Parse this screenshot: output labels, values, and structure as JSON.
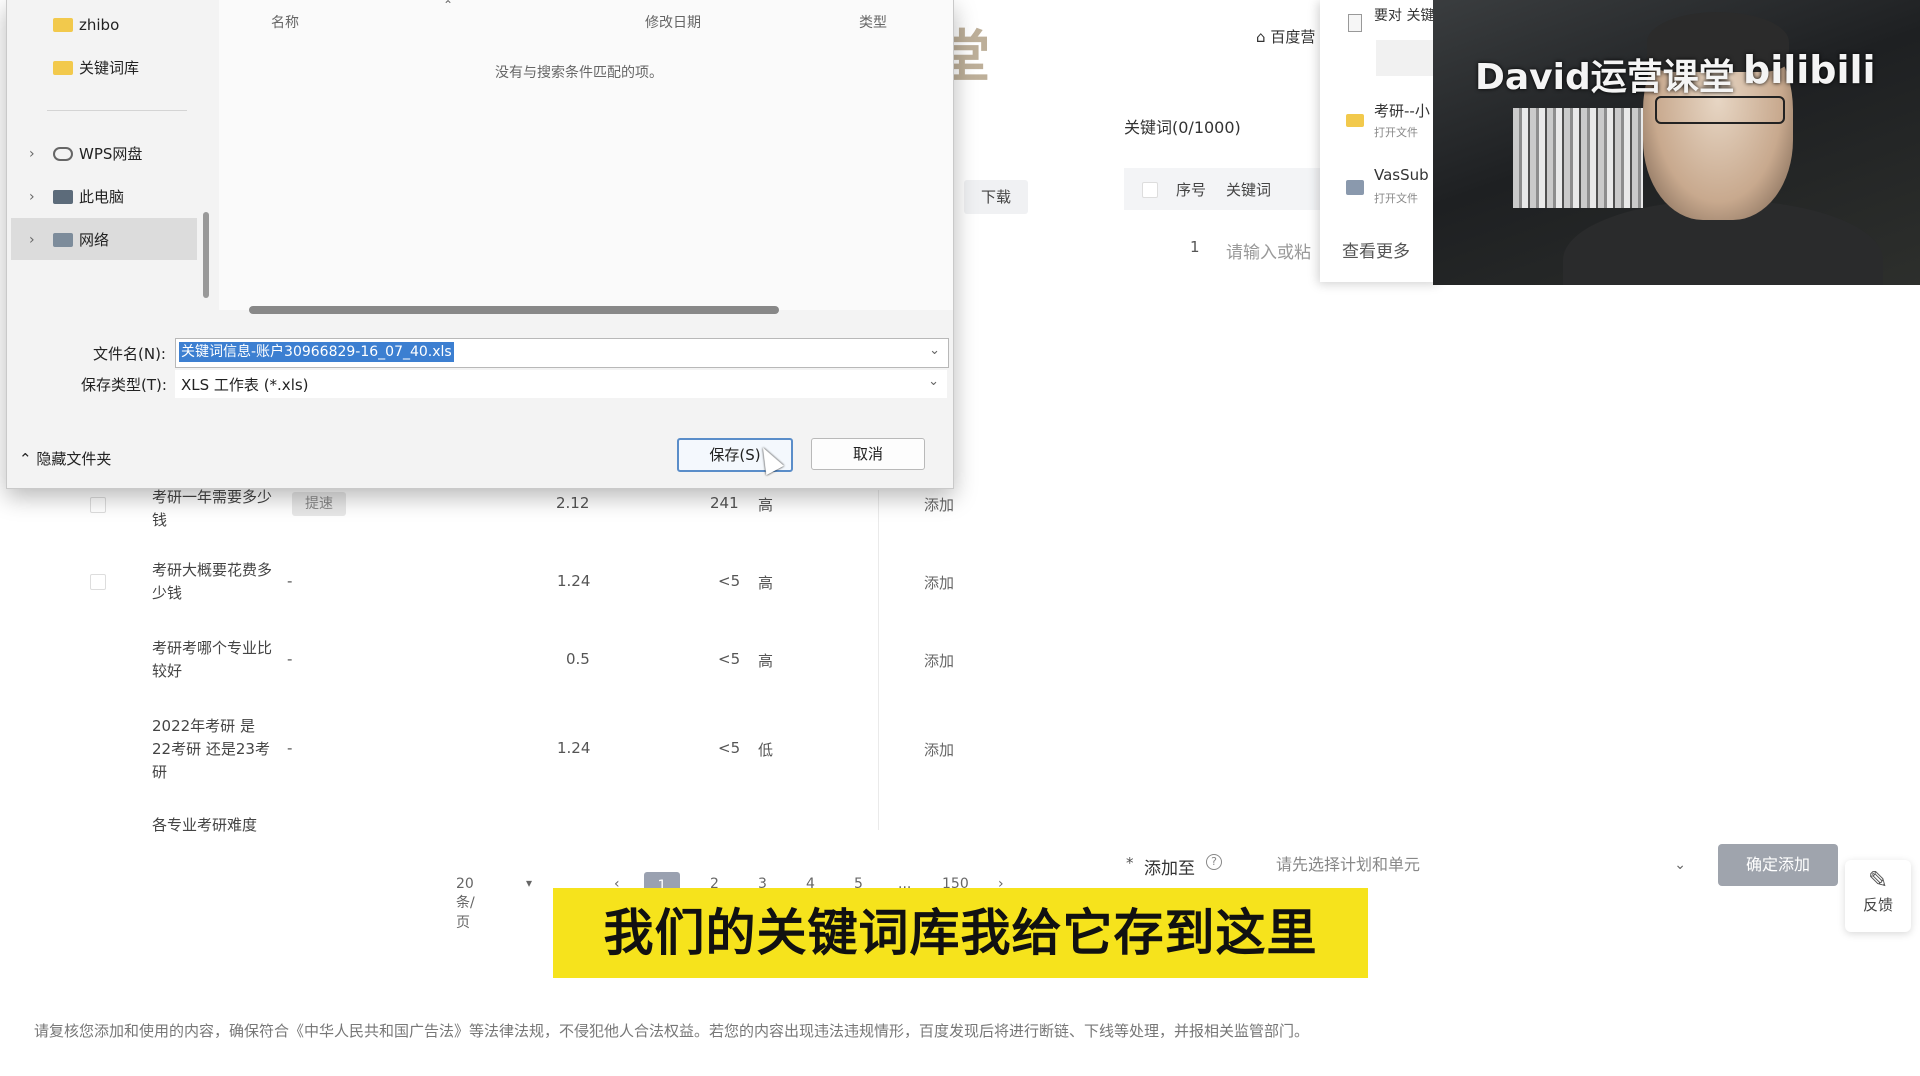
{
  "watermark": {
    "text": "大咖课堂"
  },
  "background": {
    "table_rows": [
      {
        "keyword": "考研一年需要多少钱",
        "bid_label": "提速",
        "competition": "2.12",
        "search": "241",
        "level": "高",
        "action": "添加"
      },
      {
        "keyword": "考研大概要花费多少钱",
        "bid_label": "-",
        "competition": "1.24",
        "search": "<5",
        "level": "高",
        "action": "添加"
      },
      {
        "keyword": "考研考哪个专业比较好",
        "bid_label": "-",
        "competition": "0.5",
        "search": "<5",
        "level": "高",
        "action": "添加"
      },
      {
        "keyword": "2022年考研 是22考研 还是23考研",
        "bid_label": "-",
        "competition": "1.24",
        "search": "<5",
        "level": "低",
        "action": "添加"
      },
      {
        "keyword": "各专业考研难度",
        "bid_label": "",
        "competition": "",
        "search": "",
        "level": "",
        "action": ""
      }
    ],
    "pagination": {
      "page_size": "20条/页",
      "prev": "‹",
      "pages": [
        "1",
        "2",
        "3",
        "4",
        "5",
        "...",
        "150"
      ],
      "next": "›",
      "current": "1"
    },
    "download_button": "下载",
    "breadcrumb_home": "百度营",
    "right_panel": {
      "keywords_title": "关键词(0/1000)",
      "col_index": "序号",
      "col_keyword": "关键词",
      "row_index": "1",
      "input_placeholder": "请输入或粘",
      "add_to_label": "添加至",
      "required_mark": "*",
      "select_placeholder": "请先选择计划和单元",
      "confirm_button": "确定添加"
    },
    "recent_popup": {
      "item0": "要对 关键",
      "items": [
        {
          "name": "考研--小",
          "sub": "打开文件"
        },
        {
          "name": "VasSub",
          "sub": "打开文件"
        }
      ],
      "more": "查看更多"
    },
    "feedback_label": "反馈",
    "footer_note": "请复核您添加和使用的内容，确保符合《中华人民共和国广告法》等法律法规，不侵犯他人合法权益。若您的内容出现违法违规情形，百度发现后将进行断链、下线等处理，并报相关监管部门。"
  },
  "webcam": {
    "overlay_text": "David运营课堂",
    "brand": "bilibili"
  },
  "dialog": {
    "nav_items": [
      {
        "label": "zhibo",
        "icon": "folder-icon"
      },
      {
        "label": "关键词库",
        "icon": "folder-icon"
      },
      {
        "label": "WPS网盘",
        "icon": "cloud-icon"
      },
      {
        "label": "此电脑",
        "icon": "computer-icon"
      },
      {
        "label": "网络",
        "icon": "network-icon"
      }
    ],
    "columns": {
      "name": "名称",
      "modified": "修改日期",
      "type": "类型"
    },
    "empty_message": "没有与搜索条件匹配的项。",
    "filename_label": "文件名(N):",
    "filename_value": "关键词信息-账户30966829-16_07_40.xls",
    "filetype_label": "保存类型(T):",
    "filetype_value": "XLS 工作表 (*.xls)",
    "hide_folders": "隐藏文件夹",
    "save_button": "保存(S)",
    "cancel_button": "取消"
  },
  "subtitle": "我们的关键词库我给它存到这里"
}
